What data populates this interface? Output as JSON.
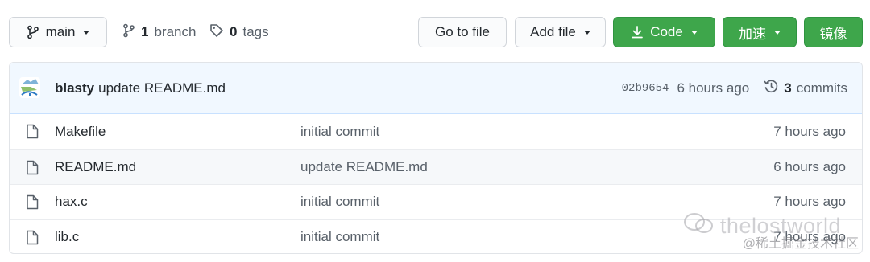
{
  "toolbar": {
    "branch_select": "main",
    "branches_count": "1",
    "branches_label": "branch",
    "tags_count": "0",
    "tags_label": "tags",
    "go_to_file": "Go to file",
    "add_file": "Add file",
    "code": "Code",
    "accelerate": "加速",
    "mirror": "镜像"
  },
  "latest_commit": {
    "author": "blasty",
    "message": "update README.md",
    "sha": "02b9654",
    "age": "6 hours ago",
    "commit_count": "3",
    "commit_label": "commits"
  },
  "files": [
    {
      "name": "Makefile",
      "message": "initial commit",
      "age": "7 hours ago"
    },
    {
      "name": "README.md",
      "message": "update README.md",
      "age": "6 hours ago"
    },
    {
      "name": "hax.c",
      "message": "initial commit",
      "age": "7 hours ago"
    },
    {
      "name": "lib.c",
      "message": "initial commit",
      "age": "7 hours ago"
    }
  ],
  "watermark": {
    "main": "thelostworld",
    "sub": "@稀土掘金技术社区"
  },
  "colors": {
    "green": "#3ea64b",
    "commit_bar": "#f1f8ff",
    "text": "#24292e",
    "muted": "#586069"
  }
}
